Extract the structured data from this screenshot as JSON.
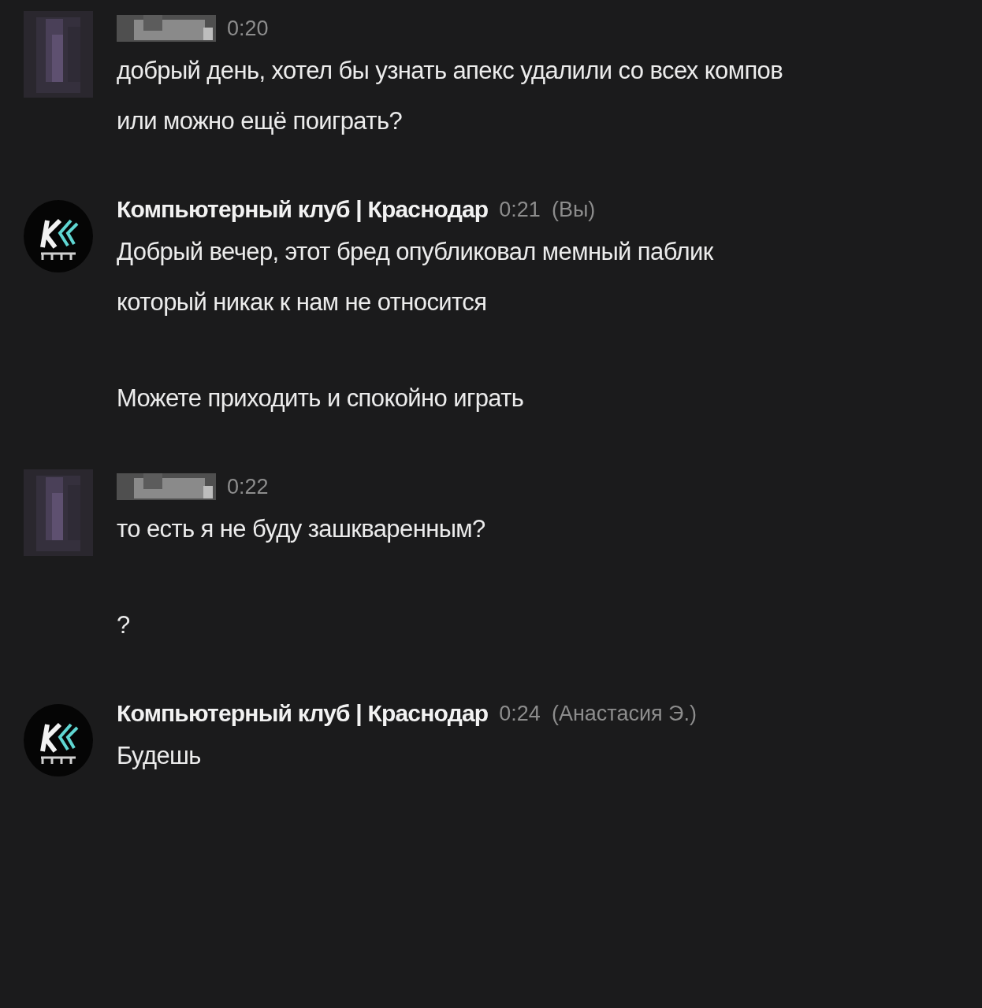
{
  "messages": [
    {
      "sender": {
        "kind": "redacted"
      },
      "time": "0:20",
      "paragraphs": [
        "добрый день, хотел бы узнать апекс удалили со всех компов\nили можно ещё поиграть?"
      ]
    },
    {
      "sender": {
        "kind": "club",
        "name": "Компьютерный клуб | Краснодар"
      },
      "time": "0:21",
      "author": "(Вы)",
      "paragraphs": [
        "Добрый вечер, этот бред опубликовал мемный паблик\nкоторый никак к нам не относится",
        "Можете приходить и спокойно играть"
      ]
    },
    {
      "sender": {
        "kind": "redacted"
      },
      "time": "0:22",
      "paragraphs": [
        "то есть я не буду зашкваренным?",
        "?"
      ]
    },
    {
      "sender": {
        "kind": "club",
        "name": "Компьютерный клуб | Краснодар"
      },
      "time": "0:24",
      "author": "(Анастасия Э.)",
      "paragraphs": [
        "Будешь"
      ]
    }
  ]
}
